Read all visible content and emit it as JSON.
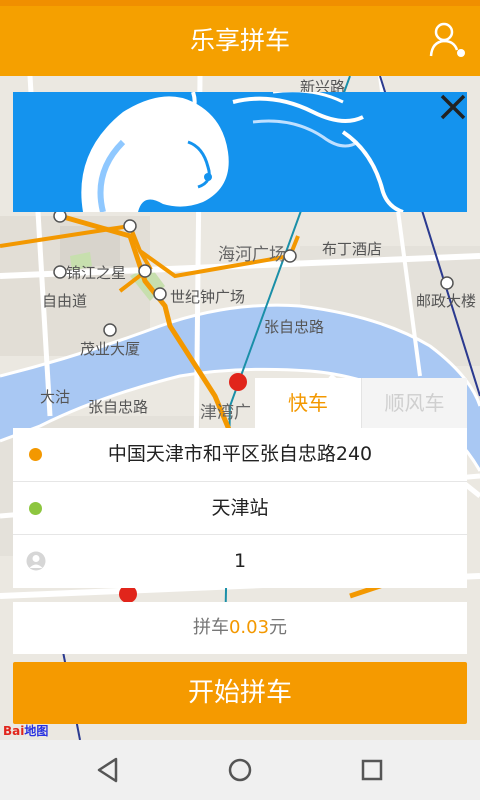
{
  "header": {
    "title": "乐享拼车",
    "user_icon": "user-icon"
  },
  "map": {
    "labels": {
      "jinjiang": "锦江之星",
      "haihe": "海河广场",
      "buding": "布丁酒店",
      "ziyoudao": "自由道",
      "century": "世纪钟广场",
      "youzheng": "邮政大楼",
      "maoye": "茂业大厦",
      "zhangzizhong1": "张自忠路",
      "zhangzizhong2": "张自忠路",
      "jinwan": "津湾广",
      "dagu": "大沽",
      "xinjialu": "新兴路"
    },
    "logo": {
      "part1": "Bai",
      "part2": "地图"
    }
  },
  "banner": {
    "close_icon": "close-icon"
  },
  "tabs": {
    "express": "快车",
    "hitch": "顺风车"
  },
  "form": {
    "origin": "中国天津市和平区张自忠路240",
    "destination": "天津站",
    "passengers": "1",
    "origin_dot_color": "#f39800",
    "destination_dot_color": "#8dc63f"
  },
  "price": {
    "prefix": "拼车",
    "amount": "0.03",
    "unit": "元"
  },
  "start_button": "开始拼车",
  "colors": {
    "accent": "#f5a000",
    "banner": "#1493ee"
  }
}
